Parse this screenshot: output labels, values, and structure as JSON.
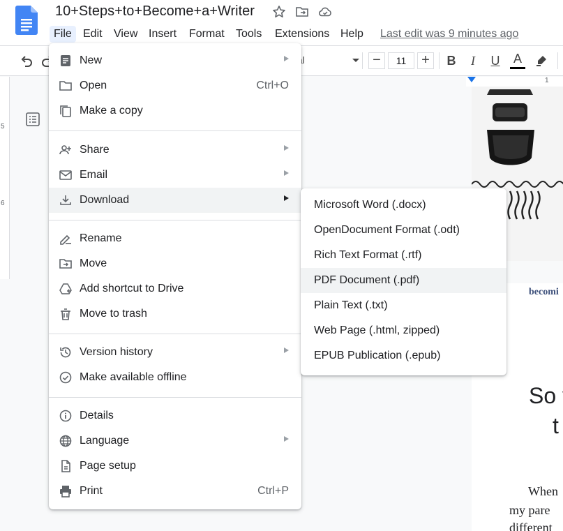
{
  "app": {
    "doc_title": "10+Steps+to+Become+a+Writer",
    "last_edit": "Last edit was 9 minutes ago"
  },
  "menubar": [
    "File",
    "Edit",
    "View",
    "Insert",
    "Format",
    "Tools",
    "Extensions",
    "Help"
  ],
  "toolbar": {
    "font_name": "al",
    "font_size": "11",
    "minus": "−",
    "plus": "+",
    "bold": "B",
    "italic": "I",
    "underline": "U",
    "text_color": "A"
  },
  "ruler": {
    "left_marks": [
      "5",
      "6"
    ],
    "top_mark": "1"
  },
  "file_menu": {
    "new": "New",
    "open": "Open",
    "open_shortcut": "Ctrl+O",
    "make_copy": "Make a copy",
    "share": "Share",
    "email": "Email",
    "download": "Download",
    "rename": "Rename",
    "move": "Move",
    "add_shortcut": "Add shortcut to Drive",
    "move_trash": "Move to trash",
    "version_history": "Version history",
    "offline": "Make available offline",
    "details": "Details",
    "language": "Language",
    "page_setup": "Page setup",
    "print": "Print",
    "print_shortcut": "Ctrl+P"
  },
  "download_menu": [
    "Microsoft Word (.docx)",
    "OpenDocument Format (.odt)",
    "Rich Text Format (.rtf)",
    "PDF Document (.pdf)",
    "Plain Text (.txt)",
    "Web Page (.html, zipped)",
    "EPUB Publication (.epub)"
  ],
  "page_preview": {
    "brand": "becomi",
    "heading1": "So y",
    "heading2": "t",
    "body1": "When",
    "body2": "my pare",
    "body3": "different"
  },
  "colors": {
    "accent": "#1a73e8",
    "menu_hover": "#f1f3f4",
    "active_menubar": "#e8f0fe"
  }
}
